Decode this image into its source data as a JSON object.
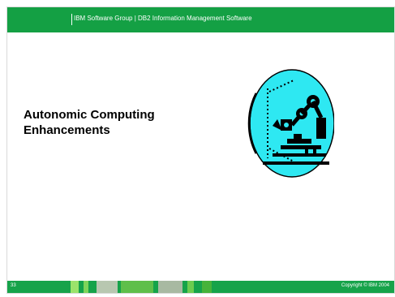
{
  "header": {
    "text": "IBM Software Group  |  DB2 Information Management Software"
  },
  "slide": {
    "title_line1": "Autonomic Computing",
    "title_line2": "Enhancements",
    "clipart_icon": "robotic-arm-icon"
  },
  "footer": {
    "page_number": "33",
    "copyright": "Copyright © IBM 2004"
  },
  "colors": {
    "header_green": "#14a044",
    "footer_green": "#16a34a",
    "clipart_cyan": "#2ee8f2"
  }
}
